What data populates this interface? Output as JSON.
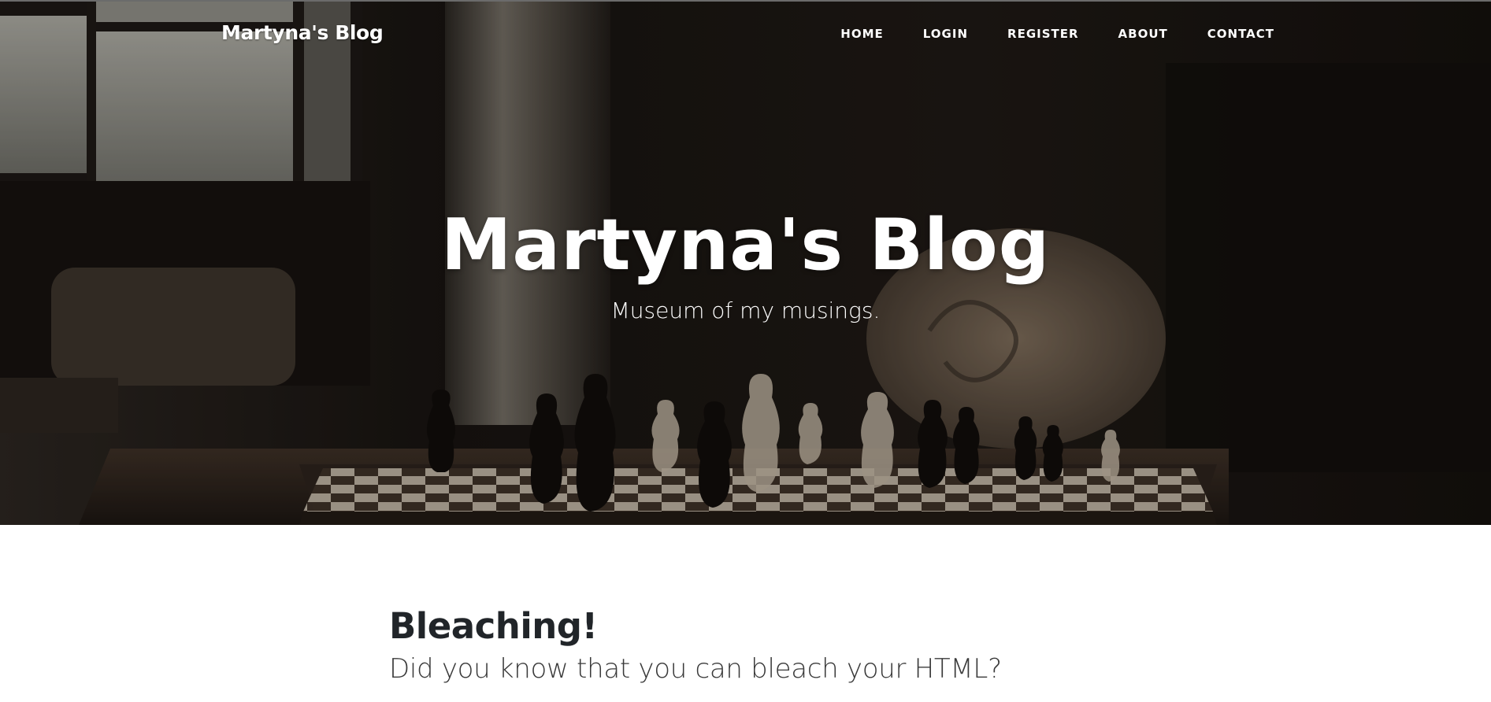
{
  "navbar": {
    "brand": "Martyna's Blog",
    "links": [
      {
        "label": "HOME"
      },
      {
        "label": "LOGIN"
      },
      {
        "label": "REGISTER"
      },
      {
        "label": "ABOUT"
      },
      {
        "label": "CONTACT"
      }
    ]
  },
  "hero": {
    "title": "Martyna's Blog",
    "subtitle": "Museum of my musings."
  },
  "posts": [
    {
      "title": "Bleaching!",
      "subtitle": "Did you know that you can bleach your HTML?"
    }
  ],
  "colors": {
    "hero_overlay": "#1b1713",
    "text_on_hero": "#ffffff",
    "post_title": "#212529",
    "post_subtitle": "#3a3a3a",
    "page_background": "#ffffff"
  }
}
